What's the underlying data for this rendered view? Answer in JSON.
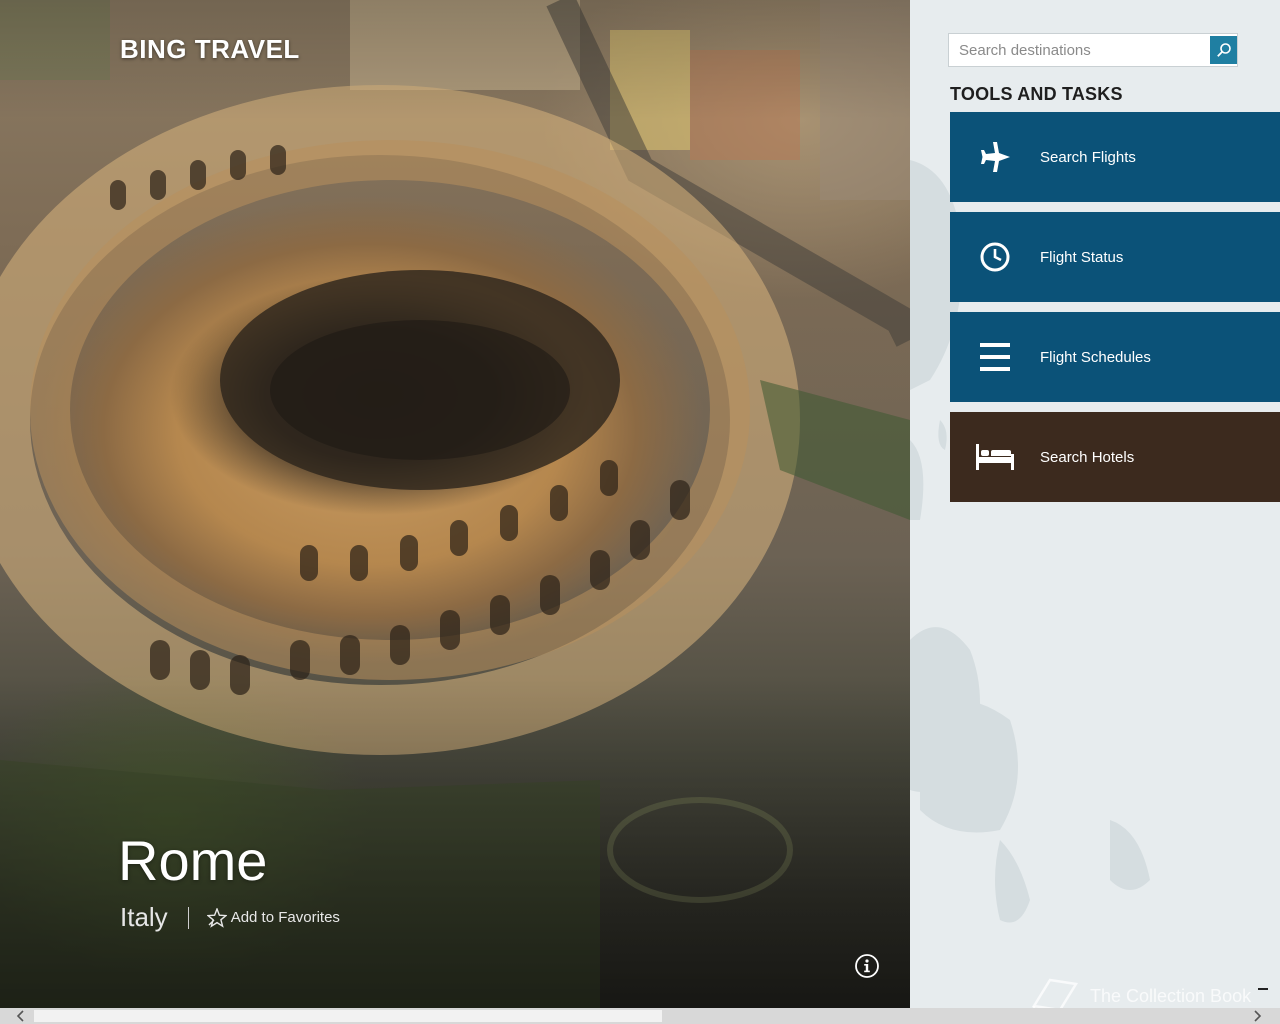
{
  "app": {
    "title": "BING TRAVEL"
  },
  "destination": {
    "city": "Rome",
    "country": "Italy",
    "favorite_label": "Add to Favorites"
  },
  "search": {
    "placeholder": "Search destinations",
    "value": ""
  },
  "tools": {
    "heading": "TOOLS AND TASKS",
    "items": [
      {
        "label": "Search Flights",
        "icon": "airplane-icon",
        "color": "#0b5278"
      },
      {
        "label": "Flight Status",
        "icon": "clock-icon",
        "color": "#0b5278"
      },
      {
        "label": "Flight Schedules",
        "icon": "list-icon",
        "color": "#0b5278"
      },
      {
        "label": "Search Hotels",
        "icon": "bed-icon",
        "color": "#3c2a1e"
      }
    ]
  },
  "watermark": {
    "text": "The Collection Book"
  },
  "colors": {
    "accent": "#1f7fa2",
    "flight_tile": "#0b5278",
    "hotel_tile": "#3c2a1e",
    "side_panel": "#e7ecee"
  },
  "scroll": {
    "position_fraction": 0.0,
    "visible_fraction": 0.51
  }
}
